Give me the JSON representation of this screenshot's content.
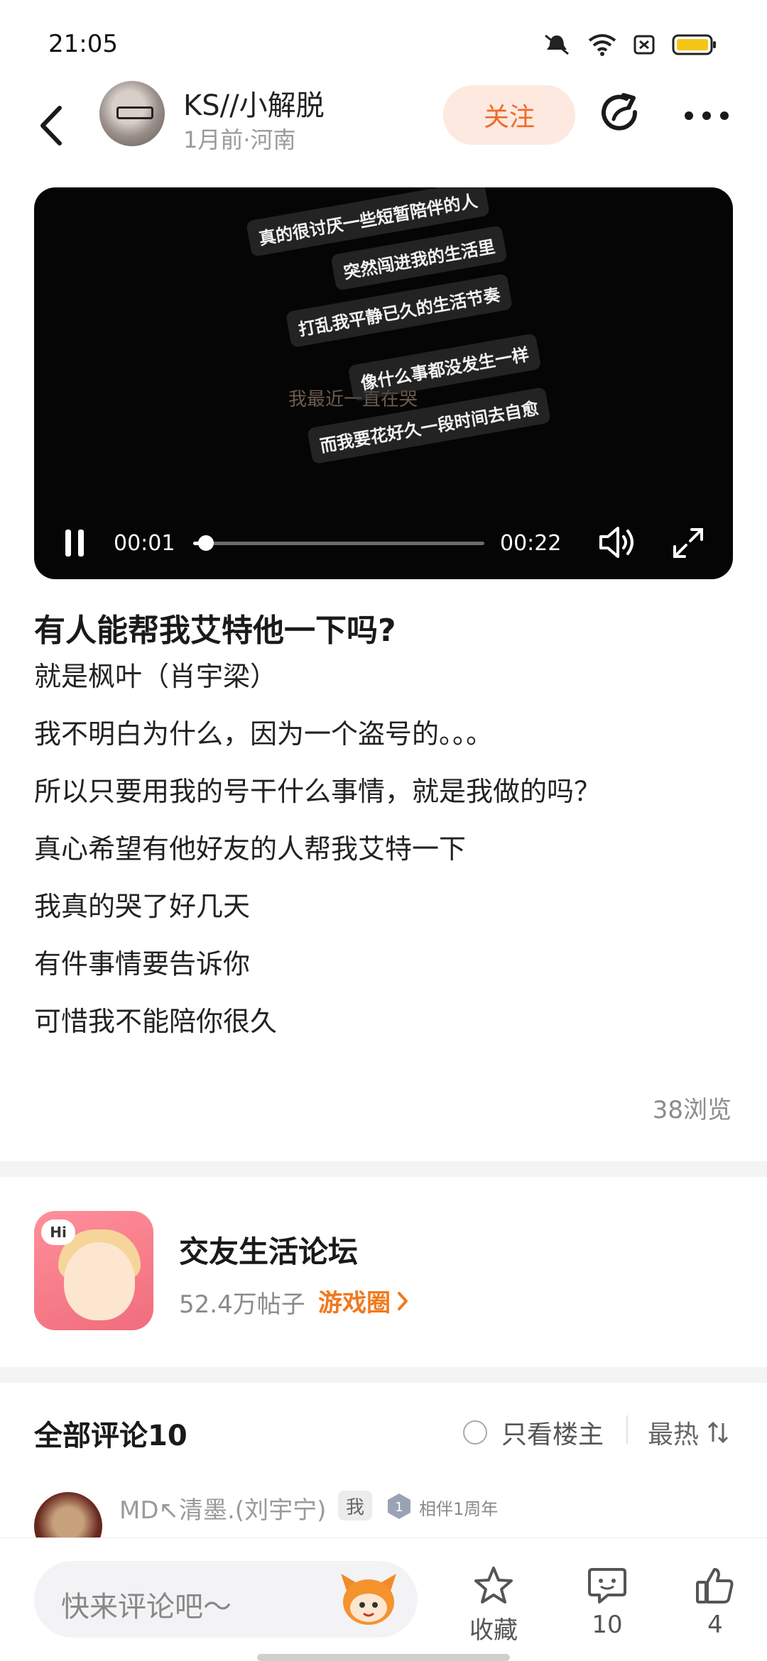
{
  "status_bar": {
    "time": "21:05"
  },
  "header": {
    "user_name": "KS//小解脱",
    "user_meta": "1月前·河南",
    "follow_label": "关注"
  },
  "video": {
    "lyrics": [
      "真的很讨厌一些短暂陪伴的人",
      "突然闯进我的生活里",
      "打乱我平静已久的生活节奏",
      "像什么事都没发生一样",
      "而我要花好久一段时间去自愈"
    ],
    "ghost_text": "我最近一直在哭",
    "current_time": "00:01",
    "total_time": "00:22",
    "progress": 0.045
  },
  "post": {
    "title": "有人能帮我艾特他一下吗?",
    "lines": [
      "就是枫叶（肖宇梁）",
      "我不明白为什么，因为一个盗号的。。。",
      "所以只要用我的号干什么事情，就是我做的吗？",
      "真心希望有他好友的人帮我艾特一下",
      "我真的哭了好几天",
      "有件事情要告诉你",
      "可惜我不能陪你很久"
    ],
    "views": "38浏览"
  },
  "forum": {
    "avatar_hi": "Hi",
    "name": "交友生活论坛",
    "posts": "52.4万帖子",
    "tag": "游戏圈"
  },
  "comments": {
    "title": "全部评论10",
    "op_only_label": "只看楼主",
    "sort_label": "最热",
    "first": {
      "user": "MD↖清墨.(刘宇宁)",
      "me_badge": "我",
      "year_badge": "相伴1周年"
    }
  },
  "bottom_bar": {
    "input_placeholder": "快来评论吧～",
    "favorite_label": "收藏",
    "comment_count": "10",
    "like_count": "4"
  },
  "colors": {
    "accent": "#f06a2a",
    "follow_bg": "#fde9e0",
    "tag": "#f07a1e"
  }
}
